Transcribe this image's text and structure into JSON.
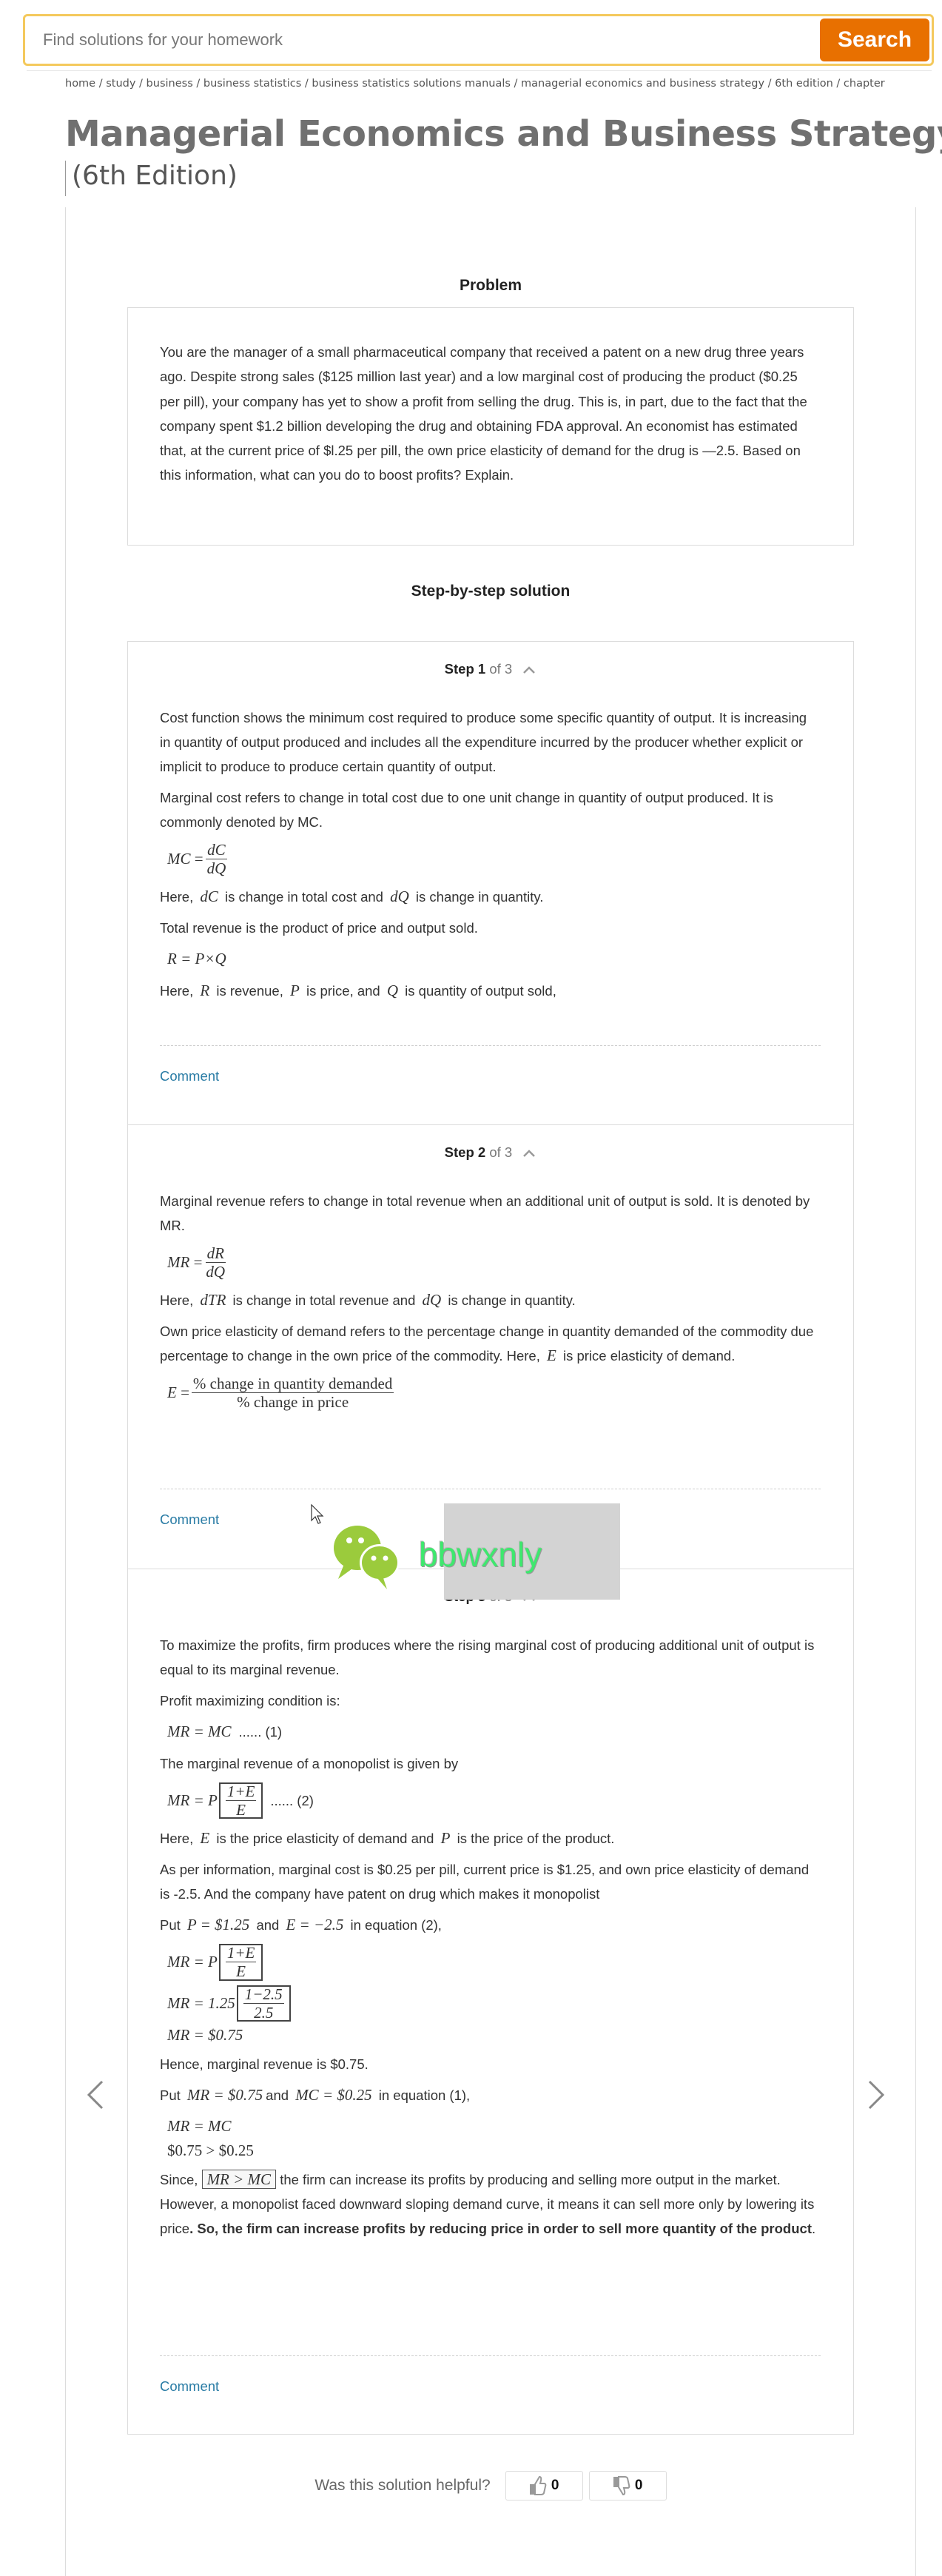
{
  "search": {
    "placeholder": "Find solutions for your homework",
    "button_label": "Search"
  },
  "breadcrumb": [
    "home",
    "study",
    "business",
    "business statistics",
    "business statistics solutions manuals",
    "managerial economics and business strategy",
    "6th edition",
    "chapter"
  ],
  "book": {
    "title": "Managerial Economics and Business Strategy",
    "edition": "(6th Edition)"
  },
  "problem": {
    "heading": "Problem",
    "text": "You are the manager of a small pharmaceutical company that received a patent on a new drug three years ago. Despite strong sales ($125 million last year) and a low marginal cost of producing the product ($0.25 per pill), your company has yet to show a profit from selling the drug. This is, in part, due to the fact that the company spent $1.2 billion developing the drug and obtaining FDA approval. An economist has estimated that, at the current price of $l.25 per pill, the own price elasticity of demand for the drug is —2.5. Based on this information, what can you do to boost profits? Explain."
  },
  "solution": {
    "heading": "Step-by-step solution",
    "step_word": "Step",
    "of_word": "of 3",
    "comment_label": "Comment",
    "steps": [
      {
        "number": "1",
        "p1": "Cost function shows the minimum cost required to produce some specific quantity of output. It is increasing in quantity of output produced and includes all the expenditure incurred by the producer whether explicit or implicit to produce to produce certain quantity of output.",
        "p2": "Marginal cost refers to change in total cost due to one unit change in quantity of output produced. It is commonly denoted by MC.",
        "eq_mc": {
          "lhs": "MC",
          "num": "dC",
          "den": "dQ"
        },
        "p3": {
          "pre": "Here,",
          "v1": "dC",
          "mid": "is change in total cost and",
          "v2": "dQ",
          "post": "is change in quantity."
        },
        "p4": "Total revenue is the product of price and output sold.",
        "eq_r": "R = P×Q",
        "p5": {
          "pre": "Here,",
          "v1": "R",
          "a": "is revenue,",
          "v2": "P",
          "b": "is price, and",
          "v3": "Q",
          "c": "is quantity of output sold,"
        }
      },
      {
        "number": "2",
        "p1": "Marginal revenue refers to change in total revenue when an additional unit of output is sold. It is denoted by MR.",
        "eq_mr": {
          "lhs": "MR",
          "num": "dR",
          "den": "dQ"
        },
        "p2": {
          "pre": "Here,",
          "v1": "dTR",
          "mid": "is change in total revenue and",
          "v2": "dQ",
          "post": "is change in quantity."
        },
        "p3": {
          "pre": "Own price elasticity of demand refers to the percentage change in quantity demanded of the commodity due percentage to change in the own price of the commodity. Here,",
          "v1": "E",
          "post": "is price elasticity of demand."
        },
        "eq_e": {
          "lhs": "E",
          "num": "% change in quantity demanded",
          "den": "% change in price"
        }
      },
      {
        "number": "3",
        "p1": "To maximize the profits, firm produces where the rising marginal cost of producing additional unit of output is equal to its marginal revenue.",
        "p2": "Profit maximizing condition is:",
        "eq1": "MR = MC",
        "eq1_tag": "...... (1)",
        "p3": "The marginal revenue of a monopolist is given by",
        "eq2": {
          "lhs": "MR = P",
          "num": "1+E",
          "den": "E",
          "tag": "...... (2)"
        },
        "p4": {
          "pre": "Here,",
          "v1": "E",
          "mid": "is the price elasticity of demand and",
          "v2": "P",
          "post": "is the price of the product."
        },
        "p5": "As per information, marginal cost is $0.25 per pill, current price is $1.25, and own price elasticity of demand is -2.5. And the company have patent on drug which makes it monopolist",
        "p6": {
          "pre": "Put",
          "v1": "P = $1.25",
          "mid": "and",
          "v2": "E = −2.5",
          "post": "in equation (2),"
        },
        "eq3": {
          "lhs": "MR = P",
          "num": "1+E",
          "den": "E"
        },
        "eq4": {
          "lhs": "MR = 1.25",
          "num": "1−2.5",
          "den": "2.5"
        },
        "eq5": "MR = $0.75",
        "p7": "Hence, marginal revenue is $0.75.",
        "p8": {
          "pre": "Put",
          "v1": "MR = $0.75",
          "mid": "and",
          "v2": "MC = $0.25",
          "post": "in equation (1),"
        },
        "eq6": "MR = MC",
        "eq7": "$0.75 > $0.25",
        "p9": {
          "pre": "Since,",
          "boxed": "MR > MC",
          "mid": "the firm can increase its profits by producing and selling more output in the market. However, a monopolist faced downward sloping demand curve, it means it can sell more only by lowering its price",
          "bold": ". So, the firm can increase profits by reducing price in order to sell more quantity of the product",
          "end": "."
        }
      }
    ]
  },
  "watermark": {
    "text": "bbwxnly"
  },
  "feedback": {
    "question": "Was this solution helpful?",
    "upvotes": "0",
    "downvotes": "0"
  },
  "colors": {
    "search_border": "#f4c95d",
    "search_button": "#e87000",
    "link": "#2a7ca5",
    "watermark_green": "#3ee86e"
  }
}
